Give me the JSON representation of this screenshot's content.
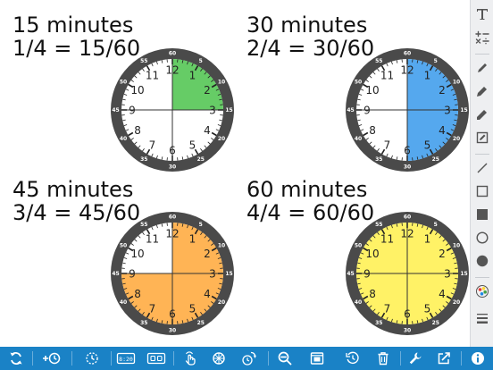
{
  "clocks": [
    {
      "id": "15",
      "title": "15 minutes",
      "fraction": "1/4 = 15/60",
      "fraction_value": 0.25,
      "fill_color": "#66cc66"
    },
    {
      "id": "30",
      "title": "30 minutes",
      "fraction": "2/4 = 30/60",
      "fraction_value": 0.5,
      "fill_color": "#55a8ee"
    },
    {
      "id": "45",
      "title": "45 minutes",
      "fraction": "3/4 = 45/60",
      "fraction_value": 0.75,
      "fill_color": "#ffb455"
    },
    {
      "id": "60",
      "title": "60 minutes",
      "fraction": "4/4 = 60/60",
      "fraction_value": 1.0,
      "fill_color": "#fff266"
    }
  ],
  "clock_face": {
    "hour_numbers": [
      "12",
      "1",
      "2",
      "3",
      "4",
      "5",
      "6",
      "7",
      "8",
      "9",
      "10",
      "11"
    ],
    "minute_labels": [
      "60",
      "5",
      "10",
      "15",
      "20",
      "25",
      "30",
      "35",
      "40",
      "45",
      "50",
      "55"
    ],
    "bezel_color": "#4a4a4a",
    "face_color": "#ffffff",
    "hand_line_color": "#333333"
  },
  "tool_palette": {
    "tools": [
      {
        "name": "text-tool",
        "icon": "text-icon"
      },
      {
        "name": "math-text-tool",
        "icon": "math-operators-icon"
      },
      {
        "name": "pen-tool",
        "icon": "pen-icon"
      },
      {
        "name": "marker-tool",
        "icon": "marker-icon"
      },
      {
        "name": "highlighter-tool",
        "icon": "highlighter-icon"
      },
      {
        "name": "edit-shape-tool",
        "icon": "edit-box-icon"
      },
      {
        "name": "line-tool",
        "icon": "line-icon"
      },
      {
        "name": "square-outline-tool",
        "icon": "square-outline-icon"
      },
      {
        "name": "square-filled-tool",
        "icon": "square-filled-icon"
      },
      {
        "name": "circle-outline-tool",
        "icon": "circle-outline-icon"
      },
      {
        "name": "circle-filled-tool",
        "icon": "circle-filled-icon"
      },
      {
        "name": "color-picker-tool",
        "icon": "color-palette-icon"
      },
      {
        "name": "line-weight-tool",
        "icon": "line-weight-icon"
      }
    ],
    "accent_color": "#1a82c6"
  },
  "bottom_toolbar": {
    "background": "#1a82c6",
    "buttons": [
      {
        "name": "reset",
        "icon": "refresh-icon"
      },
      {
        "name": "add-clock",
        "icon": "add-clock-icon"
      },
      {
        "name": "clock-settings",
        "icon": "dashed-clock-icon"
      },
      {
        "name": "digital-time",
        "icon": "digital-time-icon"
      },
      {
        "name": "time-format",
        "icon": "display-format-icon"
      },
      {
        "name": "touch-mode",
        "icon": "hand-pointer-icon"
      },
      {
        "name": "spin",
        "icon": "spinner-icon"
      },
      {
        "name": "rotate-hands",
        "icon": "rotate-hands-icon"
      },
      {
        "name": "zoom-out",
        "icon": "zoom-out-icon"
      },
      {
        "name": "background",
        "icon": "background-image-icon"
      },
      {
        "name": "history",
        "icon": "history-icon"
      },
      {
        "name": "delete",
        "icon": "trash-icon"
      },
      {
        "name": "tools",
        "icon": "wrench-icon"
      },
      {
        "name": "share",
        "icon": "share-icon"
      },
      {
        "name": "info",
        "icon": "info-icon"
      }
    ]
  }
}
